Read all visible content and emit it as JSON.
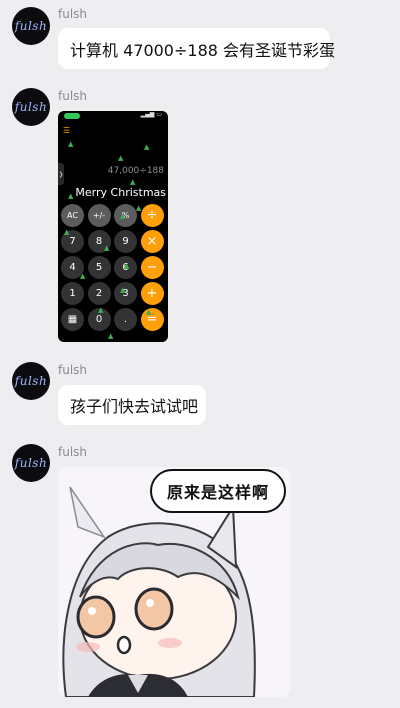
{
  "messages": [
    {
      "sender": "fulsh",
      "avatar_text": "fulsh",
      "text": "计算机 47000÷188 会有圣诞节彩蛋"
    },
    {
      "sender": "fulsh",
      "avatar_text": "fulsh",
      "image": {
        "kind": "calculator-screenshot",
        "expression": "47,000÷188",
        "result_text": "Merry Christmas",
        "keys": [
          "AC",
          "+/-",
          "%",
          "÷",
          "7",
          "8",
          "9",
          "×",
          "4",
          "5",
          "6",
          "−",
          "1",
          "2",
          "3",
          "+",
          "calc-icon",
          "0",
          ".",
          "="
        ],
        "key_types": [
          "fn",
          "fn",
          "fn",
          "op",
          "num",
          "num",
          "num",
          "op",
          "num",
          "num",
          "num",
          "op",
          "num",
          "num",
          "num",
          "op",
          "num",
          "num",
          "num",
          "op"
        ]
      }
    },
    {
      "sender": "fulsh",
      "avatar_text": "fulsh",
      "text": "孩子们快去试试吧"
    },
    {
      "sender": "fulsh",
      "avatar_text": "fulsh",
      "image": {
        "kind": "meme-sticker",
        "speech_text": "原来是这样啊"
      }
    }
  ],
  "colors": {
    "background": "#eeeef1",
    "bubble": "#ffffff",
    "accent_orange": "#ff9f0a",
    "tree_green": "#3fae52"
  }
}
